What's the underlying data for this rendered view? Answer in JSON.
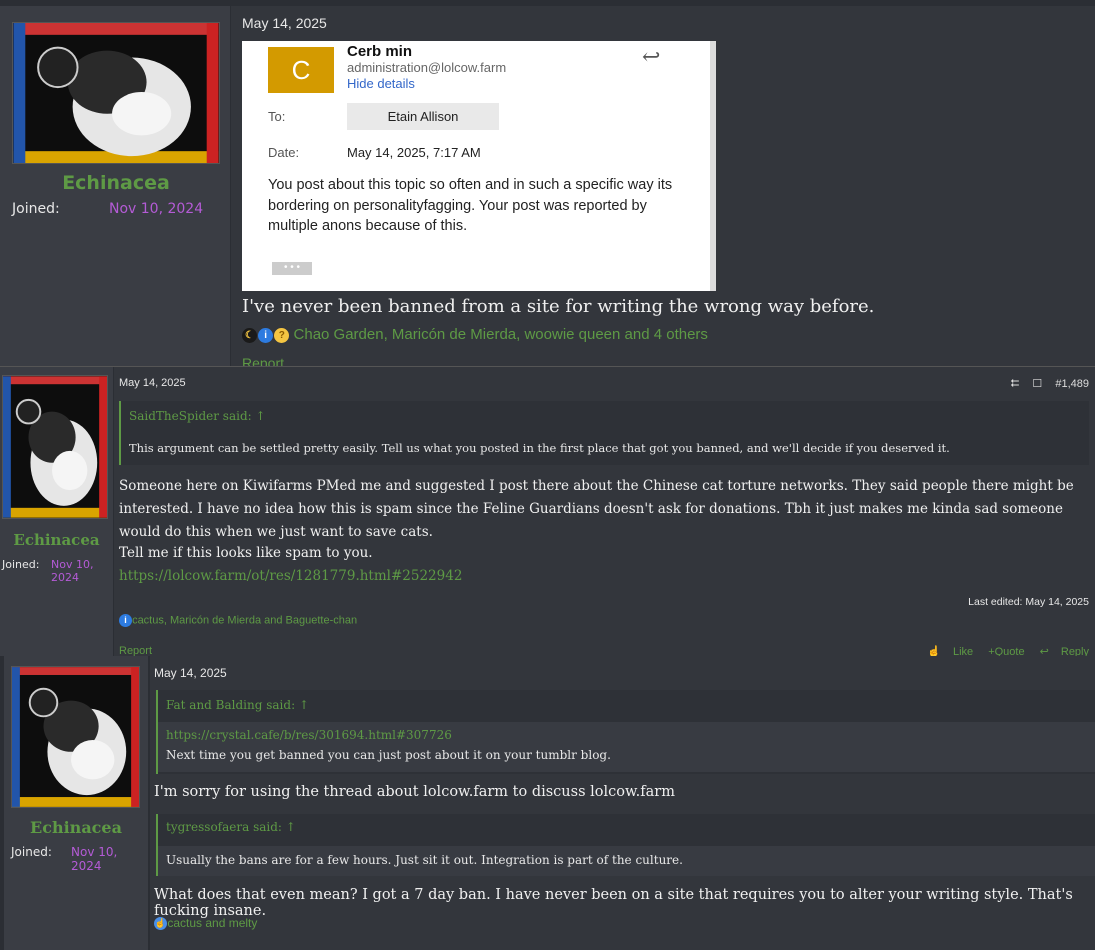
{
  "posts": [
    {
      "author": "Echinacea",
      "joined_label": "Joined:",
      "joined_date": "Nov 10, 2024",
      "date": "May 14, 2025",
      "email": {
        "avatar_letter": "C",
        "sender": "Cerb min",
        "address": "administration@lolcow.farm",
        "hide_details": "Hide details",
        "to_label": "To:",
        "to_value": "Etain Allison",
        "date_label": "Date:",
        "date_value": "May 14, 2025, 7:17 AM",
        "body": "You post about this topic so often and in such a specific way its bordering on personalityfagging. Your post was reported by multiple anons because of this.",
        "dots": "• • •"
      },
      "message": "I've never been banned from a site for writing the wrong way before.",
      "reactions": "Chao Garden, Maricón de Mierda, woowie queen and 4 others",
      "reaction_icons": [
        "crescent-moon-icon",
        "info-icon",
        "thinking-face-icon"
      ],
      "report": "Report"
    },
    {
      "author": "Echinacea",
      "joined_label": "Joined:",
      "joined_date": "Nov 10, 2024",
      "date": "May 14, 2025",
      "post_number": "#1,489",
      "quote": {
        "author_said": "SaidTheSpider said:",
        "text": "This argument can be settled pretty easily. Tell us what you posted in the first place that got you banned, and we'll decide if you deserved it."
      },
      "paragraph1": "Someone here on Kiwifarms PMed me and suggested I post there about the Chinese cat torture networks. They said people there might be interested. I have no idea how this is spam since the Feline Guardians doesn't ask for donations. Tbh it just makes me kinda sad someone would do this when we just want to save cats.",
      "paragraph2": "Tell me if this looks like spam to you.",
      "link": "https://lolcow.farm/ot/res/1281779.html#2522942",
      "last_edited": "Last edited: May 14, 2025",
      "reactions": "cactus, Maricón de Mierda and Baguette-chan",
      "report": "Report",
      "like": "Like",
      "quote_btn": "+Quote",
      "reply": "Reply"
    },
    {
      "author": "Echinacea",
      "joined_label": "Joined:",
      "joined_date": "Nov 10, 2024",
      "date": "May 14, 2025",
      "quote1": {
        "author_said": "Fat and Balding said:",
        "link": "https://crystal.cafe/b/res/301694.html#307726",
        "text": "Next time you get banned you can just post about it on your tumblr blog."
      },
      "line1": "I'm sorry for using the thread about lolcow.farm to discuss lolcow.farm",
      "quote2": {
        "author_said": "tygressofaera said:",
        "text": "Usually the bans are for a few hours. Just sit it out. Integration is part of the culture."
      },
      "line2": "What does that even mean? I got a 7 day ban. I have never been on a site that requires you to alter your writing style. That's fucking insane.",
      "reactions": "cactus and melty"
    }
  ],
  "colors": {
    "username": "#5e9a45",
    "joined_date": "#b45bd6",
    "link": "#5e9a45"
  }
}
